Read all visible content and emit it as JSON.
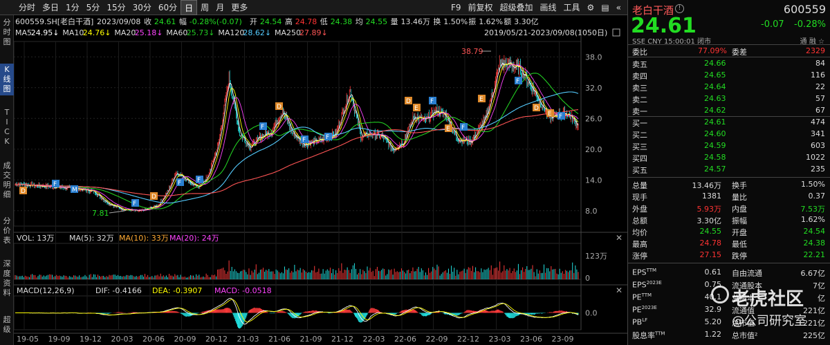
{
  "toolbar": {
    "periods": [
      "分时",
      "多日",
      "1分",
      "5分",
      "15分",
      "30分",
      "60分",
      "日",
      "周",
      "月",
      "更多"
    ],
    "selected_period": "日",
    "right": [
      "F9",
      "前复权",
      "超级叠加",
      "画线",
      "工具"
    ],
    "gear_icon": "gear-icon",
    "book_icon": "book-icon",
    "collapse_icon": "collapse-left-icon"
  },
  "sidebar": [
    "分\n时\n图",
    "K\n线\n图",
    "T\nI\nC\nK",
    "成\n交\n明\n细",
    "分\n价\n表",
    "深\n度\n资\n料",
    "超\n级"
  ],
  "sidebar_active": 1,
  "info": {
    "code": "600559.SH[老白干酒]",
    "date": "2023/09/08",
    "close_label": "收",
    "close": "24.61",
    "change_label": "幅",
    "change": "-0.28%(-0.07)",
    "open_label": "开",
    "open": "24.54",
    "high_label": "高",
    "high": "24.78",
    "low_label": "低",
    "low": "24.38",
    "avg_label": "均",
    "avg": "24.55",
    "vol_label": "量",
    "vol": "13.46万",
    "turn_label": "换",
    "turn": "1.50%",
    "amp_label": "振",
    "amp": "1.62%",
    "amt_label": "额",
    "amt": "3.30亿"
  },
  "ma": [
    {
      "label": "MA5",
      "value": "24.95↓",
      "color": "#ffffff"
    },
    {
      "label": "MA10",
      "value": "24.76↓",
      "color": "#ffff00"
    },
    {
      "label": "MA20",
      "value": "25.18↓",
      "color": "#ff44ff"
    },
    {
      "label": "MA60",
      "value": "25.73↓",
      "color": "#22cc22"
    },
    {
      "label": "MA120",
      "value": "28.62↓",
      "color": "#55ccff"
    },
    {
      "label": "MA250",
      "value": "27.89↓",
      "color": "#ff5555"
    }
  ],
  "range": "2019/05/21-2023/09/08(1050日)",
  "vol_legend": {
    "vol": "VOL: 13万",
    "ma5": "MA(5): 32万",
    "ma10": "MA(10): 33万",
    "ma20": "MA(20): 24万"
  },
  "macd_legend": {
    "name": "MACD(12,26,9)",
    "dif": "DIF: -0.4166",
    "dea": "DEA: -0.3907",
    "macd": "MACD: -0.0518"
  },
  "xaxis": [
    "19-05",
    "19-09",
    "19-12",
    "20-03",
    "20-06",
    "20-09",
    "20-12",
    "21-03",
    "21-06",
    "21-09",
    "21-12",
    "22-03",
    "22-06",
    "22-09",
    "22-12",
    "23-03",
    "23-06",
    "23-09"
  ],
  "price_axis": [
    "38.0",
    "32.0",
    "26.0",
    "20.0",
    "14.0",
    "8.0"
  ],
  "vol_axis": [
    "123万",
    "0"
  ],
  "macd_axis": [
    "0.0"
  ],
  "annot": {
    "high": "38.79",
    "low": "7.81"
  },
  "chart_data": {
    "type": "candlestick",
    "price_ylim": [
      5,
      41
    ],
    "close_key": [
      [
        0,
        13.2
      ],
      [
        40,
        12.8
      ],
      [
        80,
        12.4
      ],
      [
        110,
        11.8
      ],
      [
        130,
        9.5
      ],
      [
        150,
        8.3
      ],
      [
        175,
        7.9
      ],
      [
        200,
        9.0
      ],
      [
        215,
        12.0
      ],
      [
        225,
        15.5
      ],
      [
        240,
        14.2
      ],
      [
        255,
        12.5
      ],
      [
        270,
        14.5
      ],
      [
        285,
        21.0
      ],
      [
        300,
        34.0
      ],
      [
        315,
        23.0
      ],
      [
        330,
        20.5
      ],
      [
        345,
        22.5
      ],
      [
        360,
        23.5
      ],
      [
        375,
        27.5
      ],
      [
        390,
        23.0
      ],
      [
        405,
        21.0
      ],
      [
        420,
        21.5
      ],
      [
        435,
        22.0
      ],
      [
        450,
        23.0
      ],
      [
        470,
        31.5
      ],
      [
        485,
        22.5
      ],
      [
        500,
        23.0
      ],
      [
        515,
        22.5
      ],
      [
        530,
        20.0
      ],
      [
        545,
        21.5
      ],
      [
        560,
        26.5
      ],
      [
        575,
        25.5
      ],
      [
        590,
        27.5
      ],
      [
        605,
        26.5
      ],
      [
        620,
        22.0
      ],
      [
        640,
        21.5
      ],
      [
        660,
        26.0
      ],
      [
        680,
        36.5
      ],
      [
        695,
        36.5
      ],
      [
        710,
        35.5
      ],
      [
        725,
        32.0
      ],
      [
        740,
        28.5
      ],
      [
        750,
        26.0
      ],
      [
        760,
        26.5
      ],
      [
        775,
        27.0
      ],
      [
        790,
        24.6
      ]
    ]
  },
  "right": {
    "name": "老白干酒",
    "code": "600559",
    "price": "24.61",
    "chg": "-0.07",
    "pct": "-0.28%",
    "meta": "SSE  CNY  15:00:01 闭市",
    "meta2": "通  融  ☆",
    "wb": [
      {
        "l": "委比",
        "v": "77.09%",
        "vc": "#ff3333",
        "l2": "委差",
        "v2": "2329",
        "vc2": "#ff3333"
      }
    ],
    "sells": [
      {
        "l": "卖五",
        "p": "24.66",
        "v": "84"
      },
      {
        "l": "卖四",
        "p": "24.65",
        "v": "116"
      },
      {
        "l": "卖三",
        "p": "24.64",
        "v": "22"
      },
      {
        "l": "卖二",
        "p": "24.63",
        "v": "57"
      },
      {
        "l": "卖一",
        "p": "24.62",
        "v": "67"
      }
    ],
    "buys": [
      {
        "l": "买一",
        "p": "24.61",
        "v": "474"
      },
      {
        "l": "买二",
        "p": "24.60",
        "v": "341"
      },
      {
        "l": "买三",
        "p": "24.59",
        "v": "603"
      },
      {
        "l": "买四",
        "p": "24.58",
        "v": "1022"
      },
      {
        "l": "买五",
        "p": "24.57",
        "v": "235"
      }
    ],
    "stats": [
      {
        "l": "总量",
        "v": "13.46万",
        "c": "#ddd",
        "l2": "换手",
        "v2": "1.50%",
        "c2": "#ddd"
      },
      {
        "l": "现手",
        "v": "1381",
        "c": "#ddd",
        "l2": "量比",
        "v2": "0.37",
        "c2": "#ddd"
      },
      {
        "l": "外盘",
        "v": "5.93万",
        "c": "#ff3333",
        "l2": "内盘",
        "v2": "7.53万",
        "c2": "#22dd22"
      },
      {
        "l": "总额",
        "v": "3.30亿",
        "c": "#ddd",
        "l2": "振幅",
        "v2": "1.62%",
        "c2": "#ddd"
      },
      {
        "l": "均价",
        "v": "24.55",
        "c": "#22dd22",
        "l2": "开盘",
        "v2": "24.54",
        "c2": "#22dd22"
      },
      {
        "l": "最高",
        "v": "24.78",
        "c": "#ff3333",
        "l2": "最低",
        "v2": "24.38",
        "c2": "#22dd22"
      },
      {
        "l": "涨停",
        "v": "27.15",
        "c": "#ff3333",
        "l2": "跌停",
        "v2": "22.21",
        "c2": "#22dd22"
      }
    ],
    "fund": [
      {
        "l": "EPS",
        "s": "TTM",
        "v": "0.61",
        "l2": "自由流通",
        "v2": "6.67亿"
      },
      {
        "l": "EPS",
        "s": "2023E",
        "v": "0.75",
        "l2": "流通股本",
        "v2": "7亿"
      },
      {
        "l": "PE",
        "s": "TTM",
        "v": "40.1",
        "l2": "总股本",
        "v2": "亿"
      },
      {
        "l": "PE",
        "s": "2023E",
        "v": "32.9",
        "l2": "流通值",
        "v2": "221亿"
      },
      {
        "l": "PB",
        "s": "LF",
        "v": "5.20",
        "l2": "总市值",
        "v2": "221亿"
      },
      {
        "l": "股息率",
        "s": "TTM",
        "v": "1.22",
        "l2": "总市值²",
        "v2": "225亿"
      }
    ]
  },
  "watermark": {
    "t1": "老虎社区",
    "t2": "@公司研究室"
  }
}
